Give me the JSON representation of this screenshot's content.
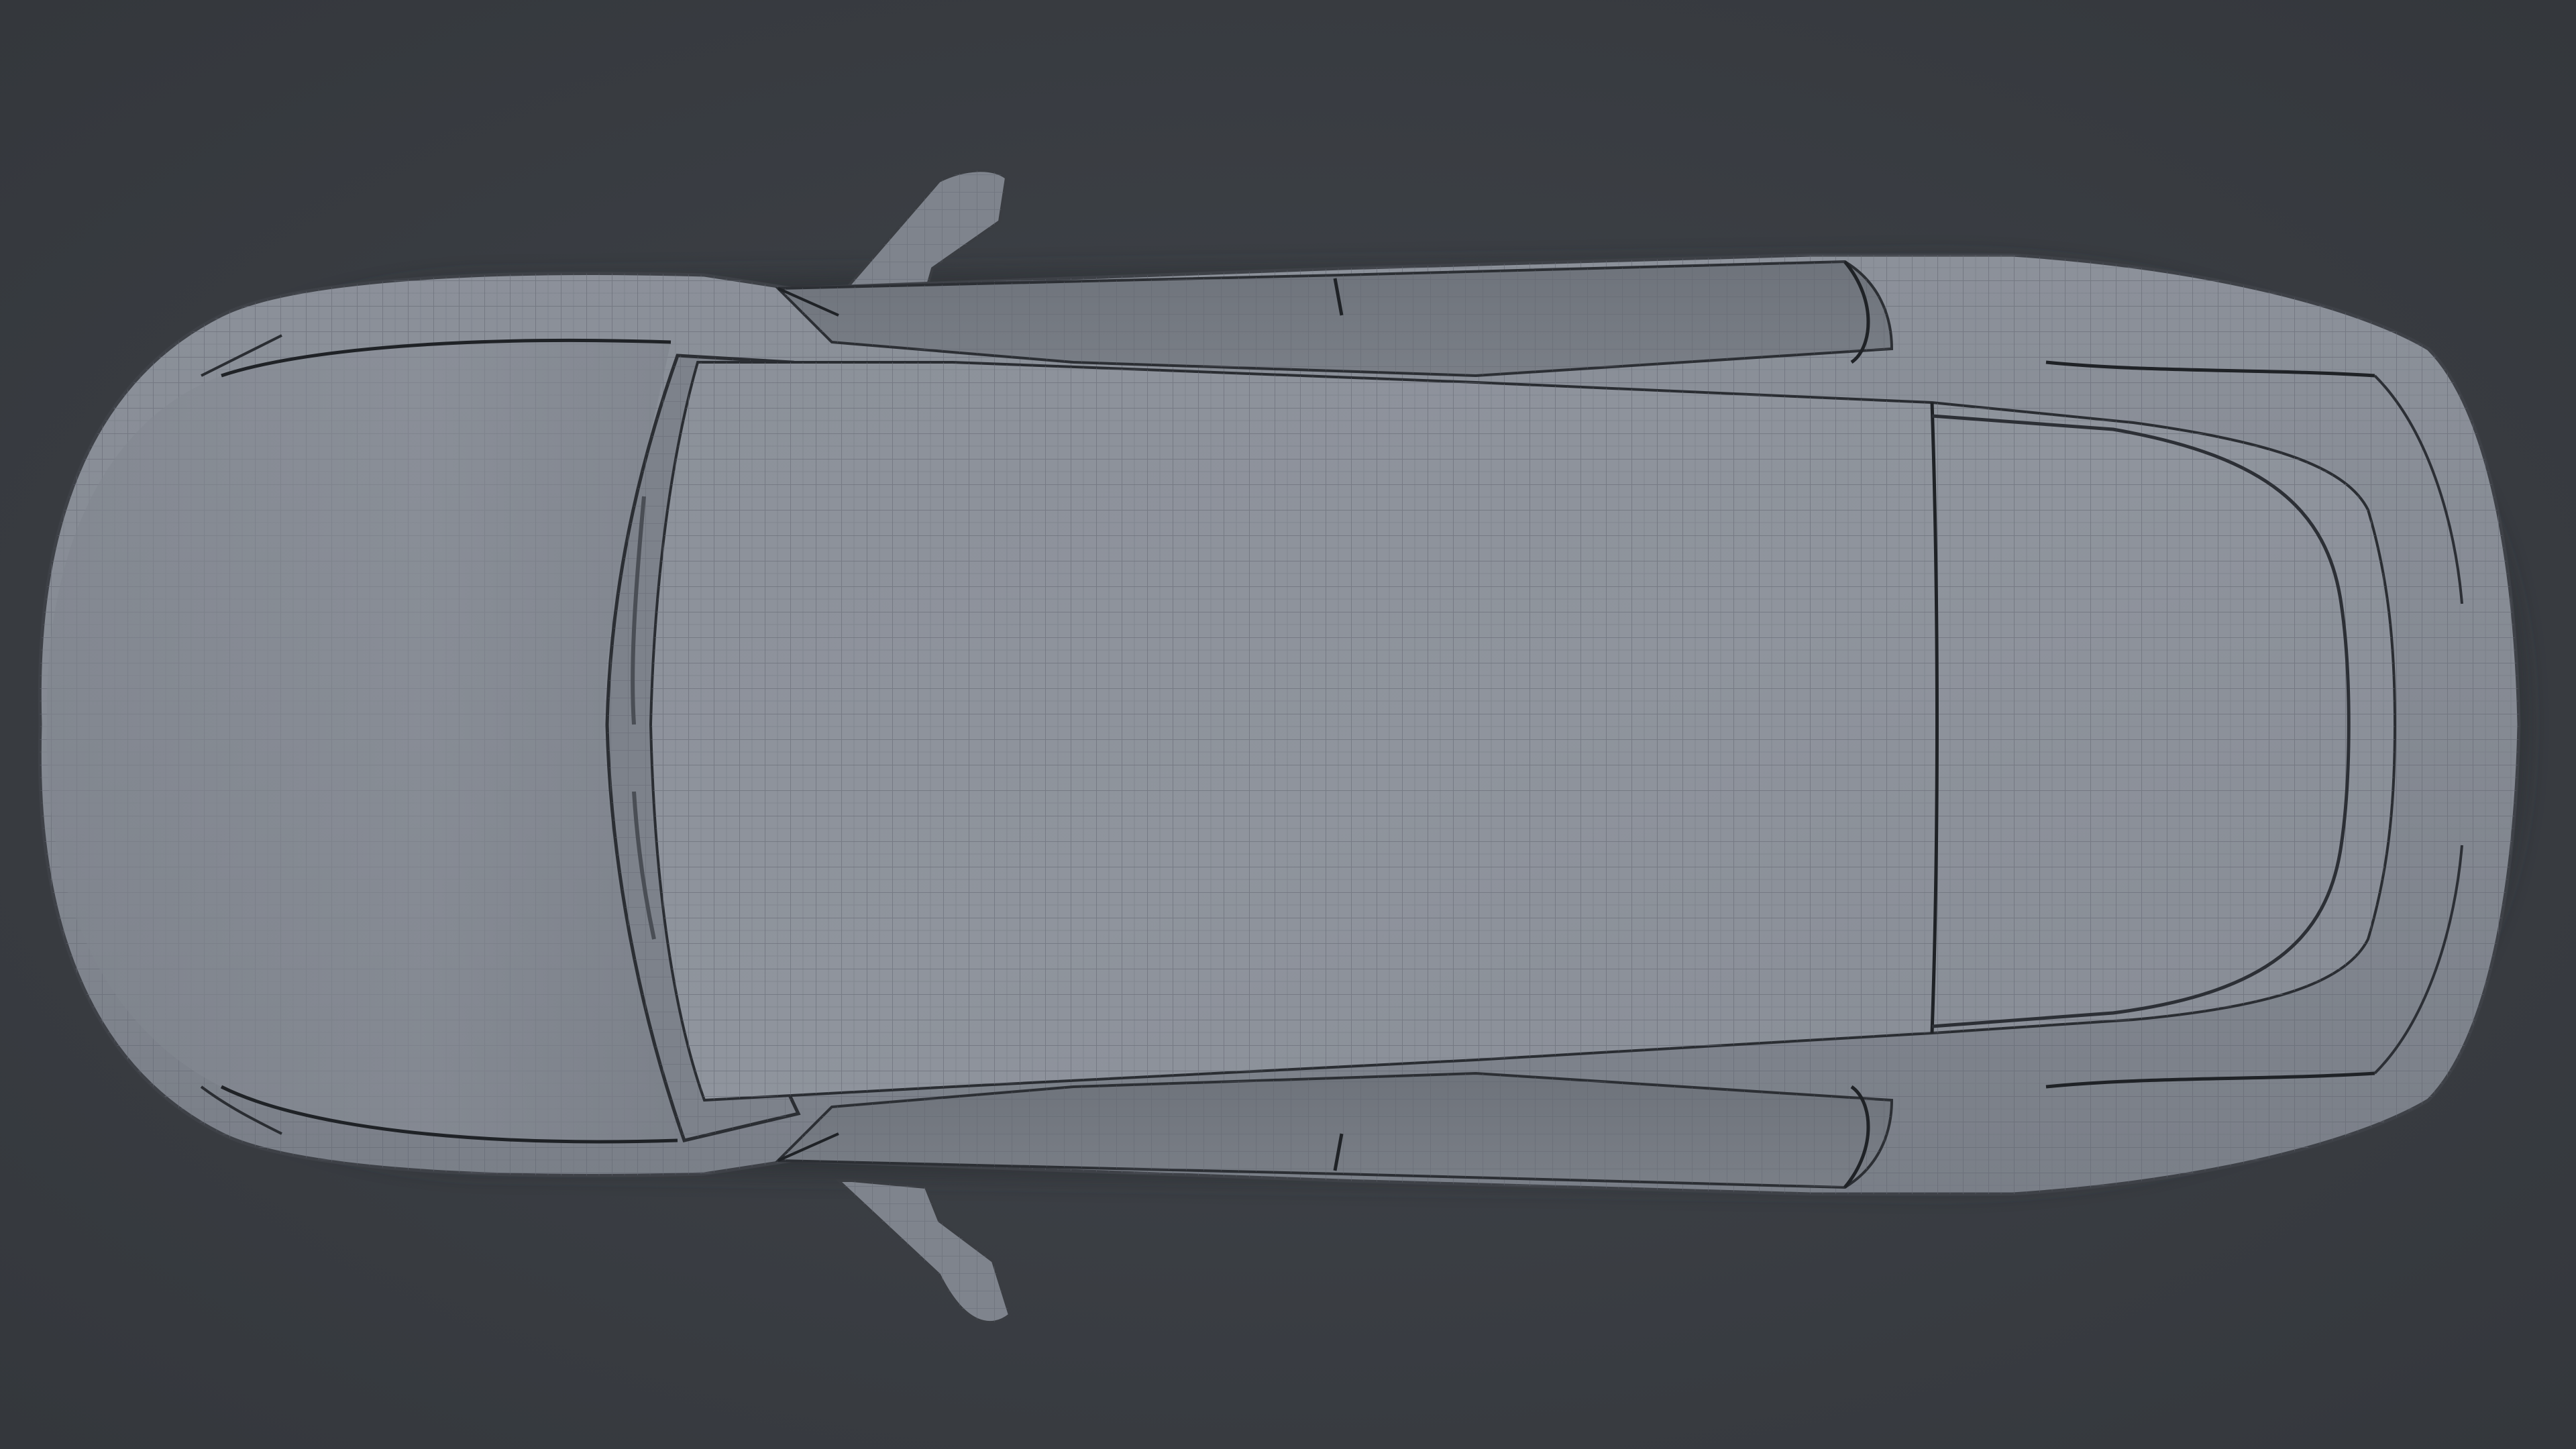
{
  "scene": {
    "background_color": "#3a3e44",
    "body_color": "#7e838c",
    "roof_color": "#8a8f98",
    "glass_color": "#6d727a",
    "wireframe_color": "#5c6068",
    "seam_color": "#202328",
    "shadow_color": "#2c2f34"
  }
}
